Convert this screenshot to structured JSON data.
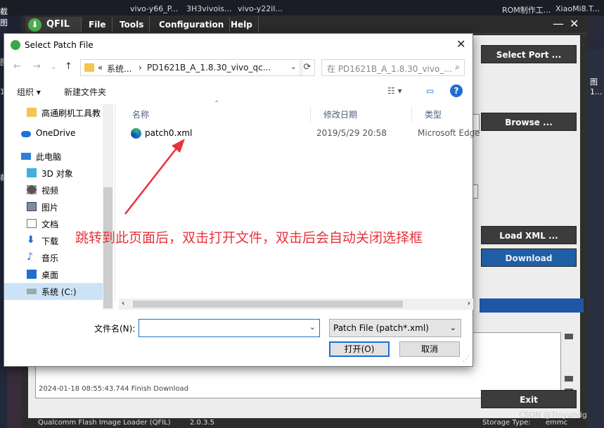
{
  "desktop": {
    "top_items": [
      "vivo-y66_P...",
      "3H3vivois...",
      "vivo-y22il...",
      "ROM制作工...",
      "XiaoMi8.T..."
    ],
    "left_items": [
      "截图",
      "图",
      "1",
      "截"
    ],
    "right_items": [
      "图",
      "1..."
    ]
  },
  "qfil": {
    "logo": "QFIL",
    "menu": [
      "File",
      "Tools",
      "Configuration",
      "Help"
    ],
    "buttons": {
      "select_port": "Select Port ...",
      "browse": "Browse ...",
      "load_xml": "Load XML ...",
      "download": "Download",
      "exit": "Exit"
    },
    "log_line": "2024-01-18 08:55:43.744    Finish Download",
    "status": {
      "app_name": "Qualcomm Flash Image Loader (QFIL)",
      "version": "2.0.3.5",
      "storage_label": "Storage Type:",
      "storage_value": "emmc"
    }
  },
  "dialog": {
    "title": "Select Patch File",
    "address": {
      "prefix": "«",
      "segment1": "系统...",
      "separator": "›",
      "segment2": "PD1621B_A_1.8.30_vivo_qc..."
    },
    "search_placeholder": "在 PD1621B_A_1.8.30_vivo_...",
    "toolbar": {
      "organize": "组织 ▾",
      "new_folder": "新建文件夹"
    },
    "nav_items": [
      {
        "label": "高通刷机工具教",
        "icon": "folder-icon"
      },
      {
        "label": "OneDrive",
        "icon": "cloud-icon"
      },
      {
        "label": "此电脑",
        "icon": "computer-icon"
      },
      {
        "label": "3D 对象",
        "icon": "cube-icon"
      },
      {
        "label": "视频",
        "icon": "video-icon"
      },
      {
        "label": "图片",
        "icon": "picture-icon"
      },
      {
        "label": "文档",
        "icon": "document-icon"
      },
      {
        "label": "下载",
        "icon": "download-icon"
      },
      {
        "label": "音乐",
        "icon": "music-icon"
      },
      {
        "label": "桌面",
        "icon": "desktop-icon"
      },
      {
        "label": "系统 (C:)",
        "icon": "drive-icon"
      }
    ],
    "columns": {
      "name": "名称",
      "date": "修改日期",
      "type": "类型"
    },
    "files": [
      {
        "name": "patch0.xml",
        "date": "2019/5/29 20:58",
        "type": "Microsoft Edge"
      }
    ],
    "filename_label": "文件名(N):",
    "filename_value": "",
    "filter": "Patch File (patch*.xml)",
    "open_button": "打开(O)",
    "cancel_button": "取消"
  },
  "annotation": "跳转到此页面后，双击打开文件，双击后会自动关闭选择框",
  "watermark": "CSDN @Tinyundg",
  "colors": {
    "accent_blue": "#1e6fd0",
    "annotation_red": "#e8333a",
    "download_blue": "#1f5fa8"
  }
}
